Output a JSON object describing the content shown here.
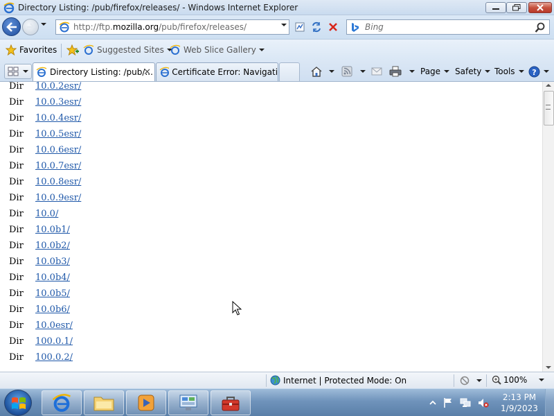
{
  "window": {
    "title": "Directory Listing: /pub/firefox/releases/ - Windows Internet Explorer"
  },
  "address": {
    "url_prefix": "http://ftp.",
    "url_host": "mozilla.org",
    "url_path": "/pub/firefox/releases/"
  },
  "search": {
    "placeholder": "Bing"
  },
  "favorites_bar": {
    "favorites_label": "Favorites",
    "items": [
      {
        "label": "Suggested Sites"
      },
      {
        "label": "Web Slice Gallery"
      }
    ]
  },
  "tabs": [
    {
      "label": "Directory Listing: /pub/...",
      "active": true
    },
    {
      "label": "Certificate Error: Navigatio...",
      "active": false
    }
  ],
  "command_bar": {
    "page_label": "Page",
    "safety_label": "Safety",
    "tools_label": "Tools"
  },
  "listing": {
    "rows": [
      {
        "kind": "Dir",
        "name": "10.0.2esr/"
      },
      {
        "kind": "Dir",
        "name": "10.0.3esr/"
      },
      {
        "kind": "Dir",
        "name": "10.0.4esr/"
      },
      {
        "kind": "Dir",
        "name": "10.0.5esr/"
      },
      {
        "kind": "Dir",
        "name": "10.0.6esr/"
      },
      {
        "kind": "Dir",
        "name": "10.0.7esr/"
      },
      {
        "kind": "Dir",
        "name": "10.0.8esr/"
      },
      {
        "kind": "Dir",
        "name": "10.0.9esr/"
      },
      {
        "kind": "Dir",
        "name": "10.0/"
      },
      {
        "kind": "Dir",
        "name": "10.0b1/"
      },
      {
        "kind": "Dir",
        "name": "10.0b2/"
      },
      {
        "kind": "Dir",
        "name": "10.0b3/"
      },
      {
        "kind": "Dir",
        "name": "10.0b4/"
      },
      {
        "kind": "Dir",
        "name": "10.0b5/"
      },
      {
        "kind": "Dir",
        "name": "10.0b6/"
      },
      {
        "kind": "Dir",
        "name": "10.0esr/"
      },
      {
        "kind": "Dir",
        "name": "100.0.1/"
      },
      {
        "kind": "Dir",
        "name": "100.0.2/"
      }
    ]
  },
  "status_bar": {
    "zone_text": "Internet | Protected Mode: On",
    "zoom": "100%"
  },
  "taskbar": {
    "apps": [
      "internet-explorer",
      "file-explorer",
      "media-player",
      "control-panel",
      "toolbox"
    ],
    "time": "2:13 PM",
    "date": "1/9/2023"
  },
  "colors": {
    "link": "#1f58a9",
    "chrome": "#cddff2",
    "taskbar": "#6f93bb"
  }
}
